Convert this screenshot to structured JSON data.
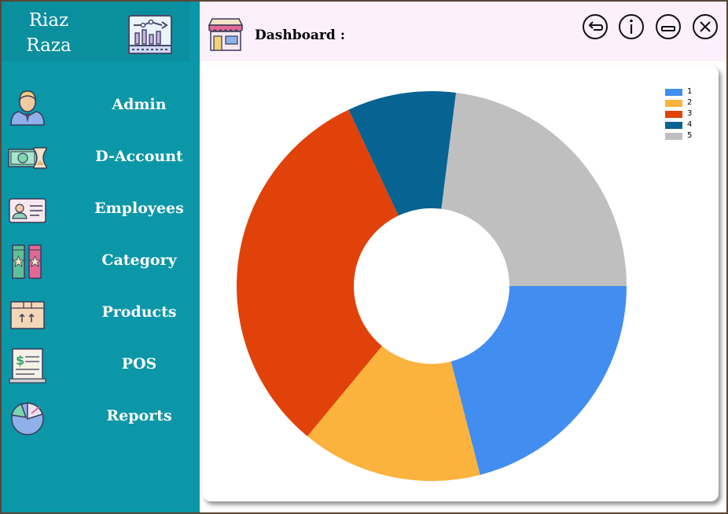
{
  "sidebar": {
    "brand": {
      "line1": "Riaz",
      "line2": "Raza"
    },
    "items": [
      {
        "label": "Admin",
        "icon": "admin-user-icon"
      },
      {
        "label": "D-Account",
        "icon": "money-hourglass-icon"
      },
      {
        "label": "Employees",
        "icon": "id-card-icon"
      },
      {
        "label": "Category",
        "icon": "category-books-icon"
      },
      {
        "label": "Products",
        "icon": "box-icon"
      },
      {
        "label": "POS",
        "icon": "receipt-icon"
      },
      {
        "label": "Reports",
        "icon": "pie-chart-icon"
      }
    ]
  },
  "header": {
    "title": "Dashboard :",
    "controls": [
      "back-icon",
      "info-icon",
      "minimize-icon",
      "close-icon"
    ]
  },
  "colors": {
    "sidebar": "#0b97a8",
    "header": "#fcf0fa"
  },
  "chart_data": {
    "type": "pie",
    "donut": true,
    "legend_position": "top-right",
    "categories": [
      "1",
      "2",
      "3",
      "4",
      "5"
    ],
    "values": [
      21,
      15,
      32,
      9,
      23
    ],
    "colors": [
      "#428df0",
      "#fbb33e",
      "#e0420a",
      "#066392",
      "#bfbfbf"
    ]
  }
}
